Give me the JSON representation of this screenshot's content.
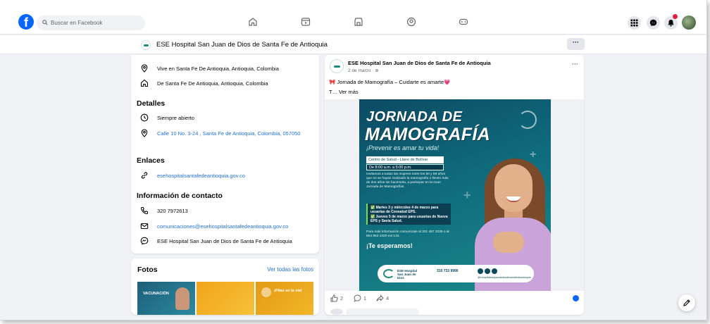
{
  "nav": {
    "logo": "f",
    "search_placeholder": "Buscar en Facebook",
    "icons": [
      "home-icon",
      "video-icon",
      "marketplace-icon",
      "groups-icon",
      "gaming-icon"
    ],
    "right_icons": [
      "menu-grid-icon",
      "messenger-icon",
      "notifications-icon"
    ]
  },
  "page_bar": {
    "title": "ESE Hospital San Juan de Dios de Santa Fe de Antioquia",
    "more_label": "···"
  },
  "info": {
    "lives_in": "Vive en Santa Fe De Antioquia, Antioquia, Colombia",
    "from": "De Santa Fe De Antioquia, Antioquia, Colombia",
    "details_heading": "Detalles",
    "hours": "Siempre abierto",
    "address": "Calle 10 No. 3-24 , Santa Fe de Antioquia, Colombia, 057050",
    "links_heading": "Enlaces",
    "website": "esehospitalsantafedeantioquia.gov.co",
    "contact_heading": "Información de contacto",
    "phone": "320 7972613",
    "email": "comunicaciones@esehospitalsantafedeantioquia.gov.co",
    "messenger": "ESE Hospital San Juan de Dios de Santa Fe de Antioquia"
  },
  "fotos": {
    "title": "Fotos",
    "see_all": "Ver todas las fotos",
    "thumb1_text": "VACUNACIÓN",
    "thumb3_text": "¡Pilas en la vía!"
  },
  "post": {
    "author": "ESE Hospital San Juan de Dios de Santa Fe de Antioquia",
    "date": "2 de marzo · ⊕",
    "text": "🎀 Jornada de Mamografía – Cuidarte es amarte💗",
    "text2": "T… Ver más",
    "more": "···",
    "poster": {
      "title1": "JORNADA DE",
      "title2": "MAMOGRAFÍA",
      "subtitle": "¡Prevenir es amar tu vida!",
      "place": "Centro de Salud - Llano de Bolívar",
      "time": "De 8:00 a.m. a 5:00 p.m.",
      "body": "Invitamos a todas las mujeres entre los 50 y 69 años que no se hayan realizado la mamografía o lleven más de dos años sin hacérsela, a participar en la Gran Jornada de Mamografías.",
      "box_line1": "✅ Martes 3 y miércoles 4 de marzo para usuarias de Coosalud EPS.",
      "box_line2": "✅ Jueves 5 de marzo para usuarias de Nueva EPS y Savia Salud.",
      "info": "Para más información comunícate al 301 487 3339 o al 604 853 1020 ext 134.",
      "cta": "¡Te esperamos!",
      "footer_name": "ESE Hospital San Juan de Dios",
      "footer_phone": "310 733 9990",
      "footer_url": "@ehospitalsanjuandediosdesantafedeantioquia"
    },
    "likes": "2",
    "comments": "1",
    "shares": "4"
  }
}
